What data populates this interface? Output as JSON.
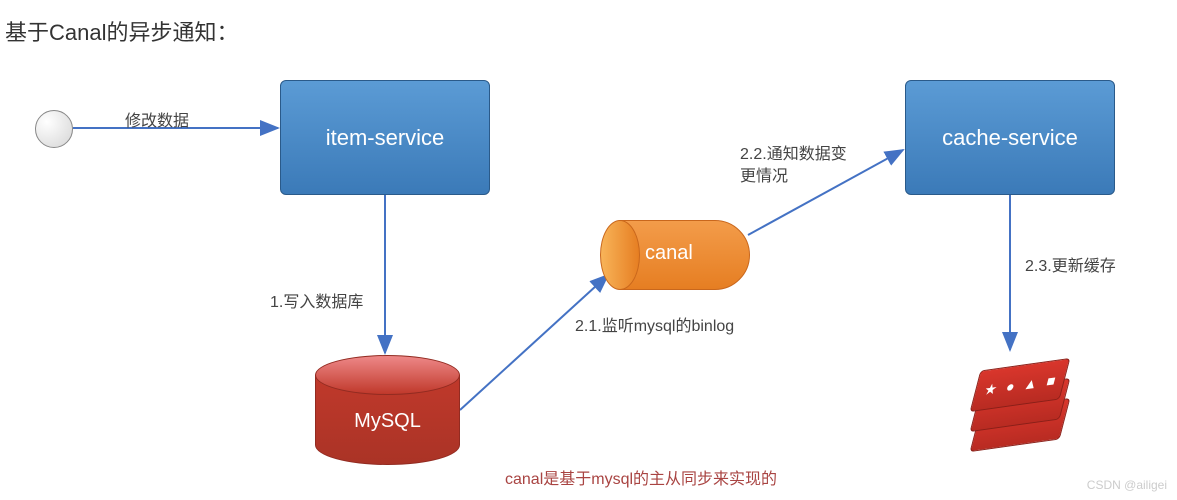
{
  "title": "基于Canal的异步通知：",
  "nodes": {
    "item_service": "item-service",
    "cache_service": "cache-service",
    "mysql": "MySQL",
    "canal": "canal"
  },
  "labels": {
    "modify_data": "修改数据",
    "write_db": "1.写入数据库",
    "listen_binlog": "2.1.监听mysql的binlog",
    "notify_change_1": "2.2.通知数据变",
    "notify_change_2": "更情况",
    "update_cache": "2.3.更新缓存"
  },
  "footnote": "canal是基于mysql的主从同步来实现的",
  "watermark": "CSDN @ailigei",
  "chart_data": {
    "type": "diagram",
    "title": "基于Canal的异步通知",
    "nodes": [
      {
        "id": "start",
        "type": "terminal",
        "label": ""
      },
      {
        "id": "item-service",
        "type": "service",
        "label": "item-service"
      },
      {
        "id": "mysql",
        "type": "database",
        "label": "MySQL"
      },
      {
        "id": "canal",
        "type": "component",
        "label": "canal"
      },
      {
        "id": "cache-service",
        "type": "service",
        "label": "cache-service"
      },
      {
        "id": "redis",
        "type": "cache",
        "label": "Redis"
      }
    ],
    "edges": [
      {
        "from": "start",
        "to": "item-service",
        "label": "修改数据"
      },
      {
        "from": "item-service",
        "to": "mysql",
        "label": "1.写入数据库"
      },
      {
        "from": "mysql",
        "to": "canal",
        "label": "2.1.监听mysql的binlog"
      },
      {
        "from": "canal",
        "to": "cache-service",
        "label": "2.2.通知数据变更情况"
      },
      {
        "from": "cache-service",
        "to": "redis",
        "label": "2.3.更新缓存"
      }
    ],
    "annotations": [
      "canal是基于mysql的主从同步来实现的"
    ]
  }
}
